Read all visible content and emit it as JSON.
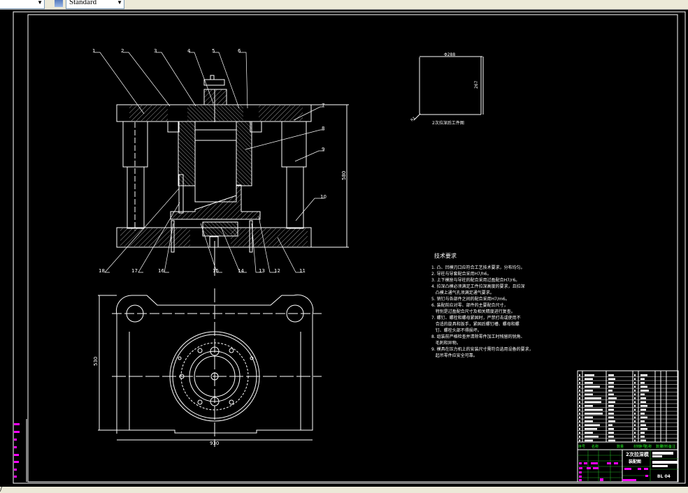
{
  "toolbar": {
    "left_combo_value": "",
    "style_combo_value": "Standard"
  },
  "status": {
    "text": "/"
  },
  "section_view": {
    "callouts": [
      "1",
      "2",
      "3",
      "4",
      "5",
      "6",
      "7",
      "8",
      "9",
      "10",
      "11",
      "12",
      "13",
      "14",
      "15",
      "16",
      "17",
      "18"
    ],
    "height_dim": "580"
  },
  "plan_view": {
    "height_dim": "530",
    "width_dim": "930"
  },
  "workpiece": {
    "diameter_dim": "Φ288",
    "height_dim": "267",
    "radius_dim": "R3",
    "caption": "2次拉深后工件图"
  },
  "tech_requirements": {
    "title": "技术要求",
    "lines": [
      "1. 凸、凹模刃口应符合工艺技术要求，分布均匀。",
      "2. 导柱与导套配合采用H7/h6。",
      "3. 上下模座与导柱的配合采用过盈配合H7/r6。",
      "4. 拉深凸模必须满足工件拉深高度的要求，且拉深",
      "   凸模上通气孔须满足通气要求。",
      "5. 销钉与各部件之间的配合采用H7/m6。",
      "6. 装配前应对零、部件的主要配合尺寸，",
      "   特别是过盈配合尺寸及相关精度进行复查。",
      "7. 螺钉、螺栓和螺母紧固时，严禁打击或使用不",
      "   合适的旋具和扳手，紧固后螺钉槽、螺母和螺",
      "   钉、螺栓头部不得损坏。",
      "8. 组装前严格检查并清除零件加工时残留的锐角、",
      "   毛刺和异物。",
      "9. 模具在压力机上的安装尺寸需符合选用设备的要求，",
      "   起吊零件应安全可靠。"
    ]
  },
  "title_block": {
    "headers": [
      "序号",
      "名称",
      "数量",
      "材料",
      "序号",
      "名称",
      "数量",
      "材料",
      "备注"
    ],
    "drawing_title": "2次拉深模",
    "drawing_subtitle": "装配图",
    "drawing_number": "BL 04"
  },
  "colors": {
    "background": "#000000",
    "lines": "#ffffff",
    "title_header": "#22ee22",
    "left_stamp": "#ff00ff",
    "toolbar": "#ece9d8"
  }
}
